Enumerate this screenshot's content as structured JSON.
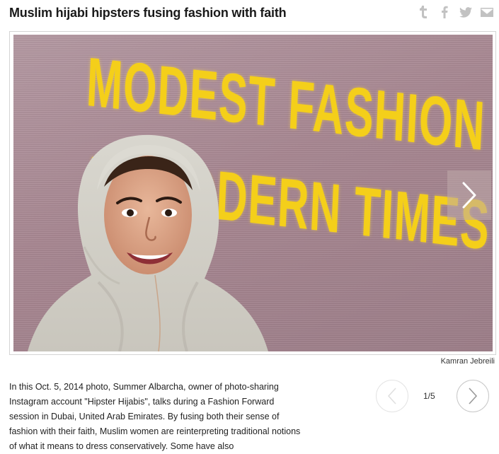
{
  "article": {
    "title": "Muslim hijabi hipsters fusing fashion with faith"
  },
  "share": {
    "icons": [
      "tumblr-icon",
      "facebook-icon",
      "twitter-icon",
      "email-icon"
    ]
  },
  "photo": {
    "screen_text_line1": "MODEST FASHION",
    "screen_text_line2": "IN MODERN TIMES",
    "credit": "Kamran Jebreili"
  },
  "caption": {
    "text": "In this Oct. 5, 2014 photo, Summer Albarcha, owner of photo-sharing Instagram account \"Hipster Hijabis\", talks during a Fashion Forward session in Dubai, United Arab Emirates. By fusing both their sense of fashion with their faith, Muslim women are reinterpreting traditional notions of what it means to dress conservatively. Some have also"
  },
  "pager": {
    "counter": "1/5"
  },
  "colors": {
    "screen_text": "#f4cf1a",
    "icon_gray": "#c2c2c2"
  }
}
